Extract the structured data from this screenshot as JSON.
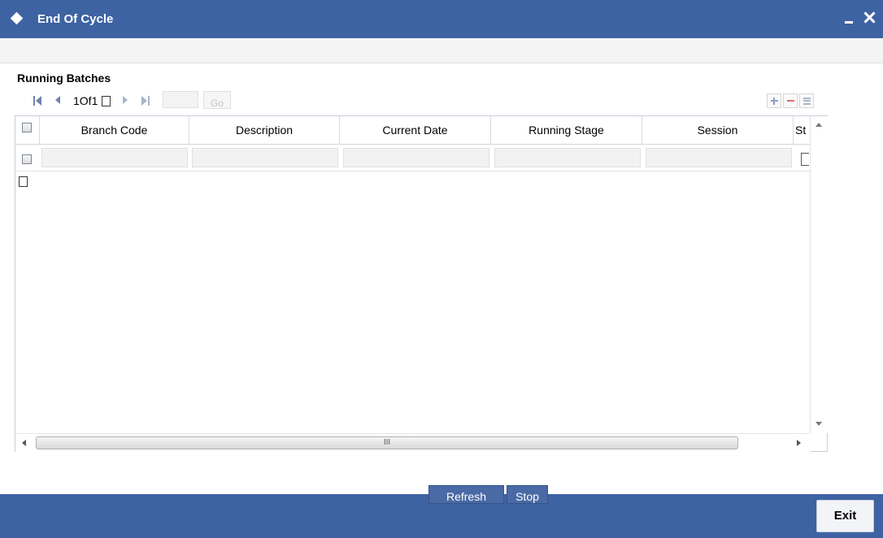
{
  "window": {
    "title": "End Of Cycle"
  },
  "section": {
    "title": "Running Batches"
  },
  "pager": {
    "label": "1Of1",
    "go_label": "Go",
    "page_input": ""
  },
  "grid": {
    "columns": [
      "Branch Code",
      "Description",
      "Current Date",
      "Running Stage",
      "Session",
      "St"
    ],
    "rows": [
      {
        "branch_code": "",
        "description": "",
        "current_date": "",
        "running_stage": "",
        "session": ""
      }
    ]
  },
  "scrollbar": {
    "thumb_label": "III"
  },
  "actions": {
    "refresh_label": "Refresh",
    "stop_label": "Stop"
  },
  "footer": {
    "exit_label": "Exit"
  },
  "colors": {
    "primary": "#3e63a3",
    "button": "#4a6aa5",
    "delete": "#e26a6a"
  }
}
